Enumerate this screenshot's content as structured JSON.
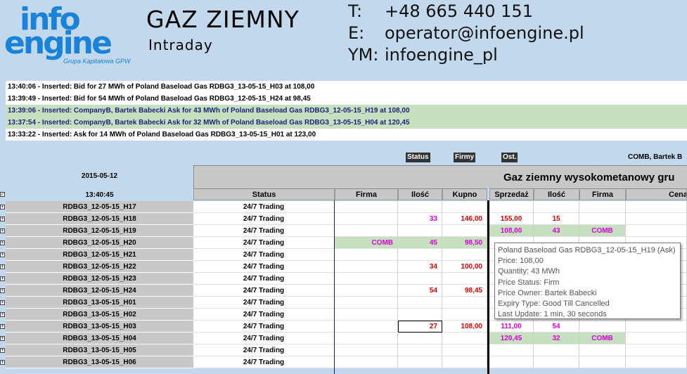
{
  "header": {
    "logo_word1": "info",
    "logo_word2": "engine",
    "logo_sub": "Grupa Kapitałowa GPW",
    "title": "GAZ ZIEMNY",
    "subtitle": "Intraday",
    "contacts": [
      {
        "key": "T:",
        "value": "+48 665 440 151"
      },
      {
        "key": "E:",
        "value": "operator@infoengine.pl"
      },
      {
        "key": "YM:",
        "value": "infoengine_pl"
      }
    ]
  },
  "log": [
    {
      "text": "13:40:06 - Inserted: Bid for 27 MWh of Poland Baseload Gas RDBG3_13-05-15_H03 at 108,00",
      "style": "white"
    },
    {
      "text": "13:39:49 - Inserted: Bid for 54 MWh of Poland Baseload Gas RDBG3_12-05-15_H24 at 98,45",
      "style": "white"
    },
    {
      "text": "13:39:06 - Inserted: CompanyB, Bartek Babecki Ask for 43 MWh of Poland Baseload Gas RDBG3_12-05-15_H19 at 108,00",
      "style": "green"
    },
    {
      "text": "13:37:54 - Inserted: CompanyB, Bartek Babecki Ask for 32 MWh of Poland Baseload Gas RDBG3_13-05-15_H04 at 120,45",
      "style": "green"
    },
    {
      "text": "13:33:22 - Inserted: Ask for 14 MWh of Poland Baseload Gas RDBG3_13-05-15_H01 at 123,00",
      "style": "white"
    }
  ],
  "toggles": {
    "status": "Status",
    "firmy": "Firmy",
    "ost": "Ost.",
    "comb_user": "COMB, Bartek B"
  },
  "grid": {
    "date": "2015-05-12",
    "time": "13:40:45",
    "group_title": "Gaz ziemny wysokometanowy gru",
    "columns": {
      "status": "Status",
      "firma_bid": "Firma",
      "ilosc_bid": "Ilość",
      "kupno": "Kupno",
      "sprzedaz": "Sprzedaż",
      "ilosc_ask": "Ilość",
      "firma_ask": "Firma",
      "cena": "Cena"
    },
    "rows": [
      {
        "name": "RDBG3_12-05-15_H17",
        "status": "24/7 Trading",
        "firma_bid": "",
        "ilosc_bid": "",
        "kupno": "",
        "sprzedaz": "",
        "ilosc_ask": "",
        "firma_ask": ""
      },
      {
        "name": "RDBG3_12-05-15_H18",
        "status": "24/7 Trading",
        "firma_bid": "",
        "ilosc_bid": "33",
        "kupno": "146,00",
        "sprzedaz": "155,00",
        "ilosc_ask": "15",
        "firma_ask": ""
      },
      {
        "name": "RDBG3_12-05-15_H19",
        "status": "24/7 Trading",
        "firma_bid": "",
        "ilosc_bid": "",
        "kupno": "",
        "sprzedaz": "108,00",
        "ilosc_ask": "43",
        "firma_ask": "COMB"
      },
      {
        "name": "RDBG3_12-05-15_H20",
        "status": "24/7 Trading",
        "firma_bid": "COMB",
        "ilosc_bid": "45",
        "kupno": "98,50",
        "sprzedaz": "",
        "ilosc_ask": "",
        "firma_ask": ""
      },
      {
        "name": "RDBG3_12-05-15_H21",
        "status": "24/7 Trading",
        "firma_bid": "",
        "ilosc_bid": "",
        "kupno": "",
        "sprzedaz": "",
        "ilosc_ask": "",
        "firma_ask": ""
      },
      {
        "name": "RDBG3_12-05-15_H22",
        "status": "24/7 Trading",
        "firma_bid": "",
        "ilosc_bid": "34",
        "kupno": "100,00",
        "sprzedaz": "",
        "ilosc_ask": "",
        "firma_ask": ""
      },
      {
        "name": "RDBG3_12-05-15_H23",
        "status": "24/7 Trading",
        "firma_bid": "",
        "ilosc_bid": "",
        "kupno": "",
        "sprzedaz": "",
        "ilosc_ask": "",
        "firma_ask": ""
      },
      {
        "name": "RDBG3_12-05-15_H24",
        "status": "24/7 Trading",
        "firma_bid": "",
        "ilosc_bid": "54",
        "kupno": "98,45",
        "sprzedaz": "",
        "ilosc_ask": "",
        "firma_ask": ""
      },
      {
        "name": "RDBG3_13-05-15_H01",
        "status": "24/7 Trading",
        "firma_bid": "",
        "ilosc_bid": "",
        "kupno": "",
        "sprzedaz": "",
        "ilosc_ask": "",
        "firma_ask": ""
      },
      {
        "name": "RDBG3_13-05-15_H02",
        "status": "24/7 Trading",
        "firma_bid": "",
        "ilosc_bid": "",
        "kupno": "",
        "sprzedaz": "",
        "ilosc_ask": "",
        "firma_ask": ""
      },
      {
        "name": "RDBG3_13-05-15_H03",
        "status": "24/7 Trading",
        "firma_bid": "",
        "ilosc_bid": "27",
        "kupno": "108,00",
        "sprzedaz": "111,00",
        "ilosc_ask": "54",
        "firma_ask": ""
      },
      {
        "name": "RDBG3_13-05-15_H04",
        "status": "24/7 Trading",
        "firma_bid": "",
        "ilosc_bid": "",
        "kupno": "",
        "sprzedaz": "120,45",
        "ilosc_ask": "32",
        "firma_ask": "COMB"
      },
      {
        "name": "RDBG3_13-05-15_H05",
        "status": "24/7 Trading",
        "firma_bid": "",
        "ilosc_bid": "",
        "kupno": "",
        "sprzedaz": "",
        "ilosc_ask": "",
        "firma_ask": ""
      },
      {
        "name": "RDBG3_13-05-15_H06",
        "status": "24/7 Trading",
        "firma_bid": "",
        "ilosc_bid": "",
        "kupno": "",
        "sprzedaz": "",
        "ilosc_ask": "",
        "firma_ask": ""
      }
    ]
  },
  "tooltip": {
    "title": "Poland Baseload Gas RDBG3_12-05-15_H19 (Ask)",
    "price": "Price: 108,00",
    "quantity": "Quantity: 43 MWh",
    "price_status": "Price Status: Firm",
    "price_owner": "Price Owner: Bartek Babecki",
    "expiry": "Expiry Type: Good Till Cancelled",
    "last_update": "Last Update: 1 min, 30 seconds"
  },
  "colors": {
    "bg": "#c2d8ec",
    "logo": "#1a82d8",
    "own_order": "#c6e0c0",
    "bid_own_qty": "#e000e0",
    "other_qty": "#e00000"
  }
}
